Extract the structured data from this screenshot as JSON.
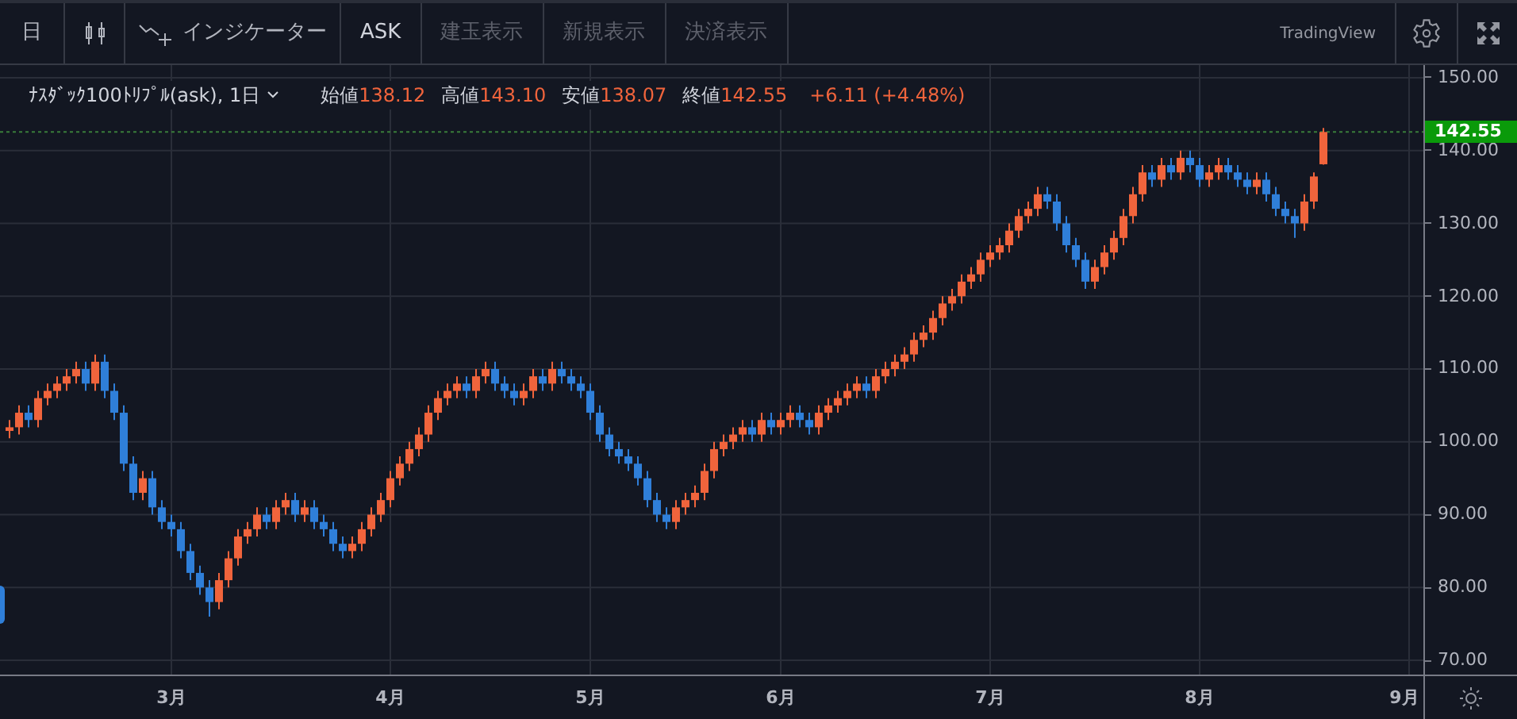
{
  "toolbar": {
    "interval": "日",
    "indicator_label": "インジケーター",
    "price_type": "ASK",
    "toggles": [
      {
        "label": "建玉表示",
        "on": false
      },
      {
        "label": "新規表示",
        "on": false
      },
      {
        "label": "決済表示",
        "on": false
      }
    ],
    "brand": "TradingView"
  },
  "legend": {
    "symbol": "ﾅｽﾀﾞｯｸ100ﾄﾘﾌﾟﾙ(ask), 1日",
    "values": [
      {
        "label": "始値",
        "value": "138.12"
      },
      {
        "label": "高値",
        "value": "143.10"
      },
      {
        "label": "安値",
        "value": "138.07"
      },
      {
        "label": "終値",
        "value": "142.55"
      }
    ],
    "change": "+6.11 (+4.48%)"
  },
  "chart": {
    "chart_data": {
      "type": "candlestick",
      "ylim": [
        68.04,
        151.74
      ],
      "grid": true,
      "ref_lines": [
        {
          "axis": "y",
          "value": 142.55,
          "label": "142.55"
        }
      ],
      "yticks": [
        {
          "value": 150,
          "label": "150.00"
        },
        {
          "value": 140,
          "label": "140.00"
        },
        {
          "value": 130,
          "label": "130.00"
        },
        {
          "value": 120,
          "label": "120.00"
        },
        {
          "value": 110,
          "label": "110.00"
        },
        {
          "value": 100,
          "label": "100.00"
        },
        {
          "value": 90,
          "label": "90.00"
        },
        {
          "value": 80,
          "label": "80.00"
        },
        {
          "value": 70,
          "label": "70.00"
        }
      ],
      "categories": [
        null,
        null,
        null,
        null,
        null,
        null,
        null,
        null,
        null,
        null,
        null,
        null,
        null,
        null,
        null,
        null,
        null,
        "3月",
        null,
        null,
        null,
        null,
        null,
        null,
        null,
        null,
        null,
        null,
        null,
        null,
        null,
        null,
        null,
        null,
        null,
        null,
        null,
        null,
        null,
        null,
        "4月",
        null,
        null,
        null,
        null,
        null,
        null,
        null,
        null,
        null,
        null,
        null,
        null,
        null,
        null,
        null,
        null,
        null,
        null,
        null,
        null,
        "5月",
        null,
        null,
        null,
        null,
        null,
        null,
        null,
        null,
        null,
        null,
        null,
        null,
        null,
        null,
        null,
        null,
        null,
        null,
        null,
        "6月",
        null,
        null,
        null,
        null,
        null,
        null,
        null,
        null,
        null,
        null,
        null,
        null,
        null,
        null,
        null,
        null,
        null,
        null,
        null,
        null,
        null,
        "7月",
        null,
        null,
        null,
        null,
        null,
        null,
        null,
        null,
        null,
        null,
        null,
        null,
        null,
        null,
        null,
        null,
        null,
        null,
        null,
        null,
        null,
        "8月",
        null,
        null,
        null,
        null,
        null,
        null,
        null,
        null,
        null,
        null,
        null,
        null,
        null,
        null,
        null,
        null,
        null,
        null,
        null,
        null,
        null,
        "9月"
      ],
      "series": [
        {
          "ohlc": [
            [
              101.5,
              103,
              100.5,
              102
            ],
            [
              102,
              105,
              101,
              104
            ],
            [
              104,
              105,
              102,
              103
            ],
            [
              103,
              107,
              102,
              106
            ],
            [
              106,
              108,
              105,
              107
            ],
            [
              107,
              109,
              106,
              108
            ],
            [
              108,
              110,
              107,
              109
            ],
            [
              109,
              111,
              108,
              110
            ],
            [
              110,
              111,
              107,
              108
            ],
            [
              108,
              112,
              107,
              111
            ],
            [
              111,
              112,
              106,
              107
            ],
            [
              107,
              108,
              103,
              104
            ],
            [
              104,
              105,
              96,
              97
            ],
            [
              97,
              98,
              92,
              93
            ],
            [
              93,
              96,
              92,
              95
            ],
            [
              95,
              96,
              90,
              91
            ],
            [
              91,
              92,
              88,
              89
            ],
            [
              89,
              90,
              87,
              88
            ],
            [
              88,
              89,
              84,
              85
            ],
            [
              85,
              86,
              81,
              82
            ],
            [
              82,
              83,
              79,
              80
            ],
            [
              80,
              81,
              76,
              78
            ],
            [
              78,
              82,
              77,
              81
            ],
            [
              81,
              85,
              80,
              84
            ],
            [
              84,
              88,
              83,
              87
            ],
            [
              87,
              89,
              86,
              88
            ],
            [
              88,
              91,
              87,
              90
            ],
            [
              90,
              91,
              88,
              89
            ],
            [
              89,
              92,
              88,
              91
            ],
            [
              91,
              93,
              90,
              92
            ],
            [
              92,
              93,
              89,
              90
            ],
            [
              90,
              92,
              89,
              91
            ],
            [
              91,
              92,
              88,
              89
            ],
            [
              89,
              90,
              87,
              88
            ],
            [
              88,
              89,
              85,
              86
            ],
            [
              86,
              87,
              84,
              85
            ],
            [
              85,
              87,
              84,
              86
            ],
            [
              86,
              89,
              85,
              88
            ],
            [
              88,
              91,
              87,
              90
            ],
            [
              90,
              93,
              89,
              92
            ],
            [
              92,
              96,
              91,
              95
            ],
            [
              95,
              98,
              94,
              97
            ],
            [
              97,
              100,
              96,
              99
            ],
            [
              99,
              102,
              98,
              101
            ],
            [
              101,
              105,
              100,
              104
            ],
            [
              104,
              107,
              103,
              106
            ],
            [
              106,
              108,
              105,
              107
            ],
            [
              107,
              109,
              106,
              108
            ],
            [
              108,
              109,
              106,
              107
            ],
            [
              107,
              110,
              106,
              109
            ],
            [
              109,
              111,
              108,
              110
            ],
            [
              110,
              111,
              107,
              108
            ],
            [
              108,
              109,
              106,
              107
            ],
            [
              107,
              108,
              105,
              106
            ],
            [
              106,
              108,
              105,
              107
            ],
            [
              107,
              110,
              106,
              109
            ],
            [
              109,
              110,
              107,
              108
            ],
            [
              108,
              111,
              107,
              110
            ],
            [
              110,
              111,
              108,
              109
            ],
            [
              109,
              110,
              107,
              108
            ],
            [
              108,
              109,
              106,
              107
            ],
            [
              107,
              108,
              103,
              104
            ],
            [
              104,
              105,
              100,
              101
            ],
            [
              101,
              102,
              98,
              99
            ],
            [
              99,
              100,
              97,
              98
            ],
            [
              98,
              99,
              96,
              97
            ],
            [
              97,
              98,
              94,
              95
            ],
            [
              95,
              96,
              91,
              92
            ],
            [
              92,
              93,
              89,
              90
            ],
            [
              90,
              91,
              88,
              89
            ],
            [
              89,
              92,
              88,
              91
            ],
            [
              91,
              93,
              90,
              92
            ],
            [
              92,
              94,
              91,
              93
            ],
            [
              93,
              97,
              92,
              96
            ],
            [
              96,
              100,
              95,
              99
            ],
            [
              99,
              101,
              98,
              100
            ],
            [
              100,
              102,
              99,
              101
            ],
            [
              101,
              103,
              100,
              102
            ],
            [
              102,
              103,
              100,
              101
            ],
            [
              101,
              104,
              100,
              103
            ],
            [
              103,
              104,
              101,
              102
            ],
            [
              102,
              104,
              101,
              103
            ],
            [
              103,
              105,
              102,
              104
            ],
            [
              104,
              105,
              102,
              103
            ],
            [
              103,
              104,
              101,
              102
            ],
            [
              102,
              105,
              101,
              104
            ],
            [
              104,
              106,
              103,
              105
            ],
            [
              105,
              107,
              104,
              106
            ],
            [
              106,
              108,
              105,
              107
            ],
            [
              107,
              109,
              106,
              108
            ],
            [
              108,
              109,
              106,
              107
            ],
            [
              107,
              110,
              106,
              109
            ],
            [
              109,
              111,
              108,
              110
            ],
            [
              110,
              112,
              109,
              111
            ],
            [
              111,
              113,
              110,
              112
            ],
            [
              112,
              115,
              111,
              114
            ],
            [
              114,
              116,
              113,
              115
            ],
            [
              115,
              118,
              114,
              117
            ],
            [
              117,
              120,
              116,
              119
            ],
            [
              119,
              121,
              118,
              120
            ],
            [
              120,
              123,
              119,
              122
            ],
            [
              122,
              124,
              121,
              123
            ],
            [
              123,
              126,
              122,
              125
            ],
            [
              125,
              127,
              124,
              126
            ],
            [
              126,
              128,
              125,
              127
            ],
            [
              127,
              130,
              126,
              129
            ],
            [
              129,
              132,
              128,
              131
            ],
            [
              131,
              133,
              130,
              132
            ],
            [
              132,
              135,
              131,
              134
            ],
            [
              134,
              135,
              132,
              133
            ],
            [
              133,
              134,
              129,
              130
            ],
            [
              130,
              131,
              126,
              127
            ],
            [
              127,
              128,
              124,
              125
            ],
            [
              125,
              126,
              121,
              122
            ],
            [
              122,
              125,
              121,
              124
            ],
            [
              124,
              127,
              123,
              126
            ],
            [
              126,
              129,
              125,
              128
            ],
            [
              128,
              132,
              127,
              131
            ],
            [
              131,
              135,
              130,
              134
            ],
            [
              134,
              138,
              133,
              137
            ],
            [
              137,
              138,
              135,
              136
            ],
            [
              136,
              139,
              135,
              138
            ],
            [
              138,
              139,
              136,
              137
            ],
            [
              137,
              140,
              136,
              139
            ],
            [
              139,
              140,
              137,
              138
            ],
            [
              138,
              139,
              135,
              136
            ],
            [
              136,
              138,
              135,
              137
            ],
            [
              137,
              139,
              136,
              138
            ],
            [
              138,
              139,
              136,
              137
            ],
            [
              137,
              138,
              135,
              136
            ],
            [
              136,
              137,
              134,
              135
            ],
            [
              135,
              137,
              134,
              136
            ],
            [
              136,
              137,
              133,
              134
            ],
            [
              134,
              135,
              131,
              132
            ],
            [
              132,
              133,
              130,
              131
            ],
            [
              131,
              132,
              128,
              130
            ],
            [
              130,
              134,
              129,
              133
            ],
            [
              133,
              137,
              132,
              136.44
            ],
            [
              138.12,
              143.1,
              138.07,
              142.55
            ],
            null,
            null,
            null,
            null,
            null,
            null,
            null,
            null,
            null
          ]
        }
      ]
    }
  }
}
